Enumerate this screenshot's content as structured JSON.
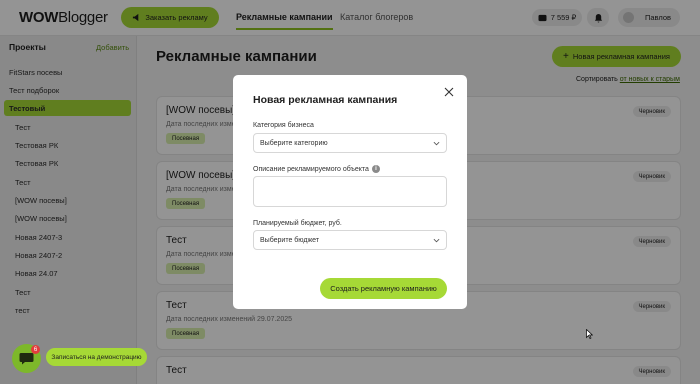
{
  "header": {
    "logo_bold": "WOW",
    "logo_rest": "Blogger",
    "order_button": "Заказать рекламу",
    "tabs": [
      {
        "label": "Рекламные кампании"
      },
      {
        "label": "Каталог блогеров"
      }
    ],
    "balance": "7 559 ₽",
    "user_name": "Павлов"
  },
  "sidebar": {
    "title": "Проекты",
    "add_label": "Добавить",
    "items": [
      {
        "label": "FitStars посевы"
      },
      {
        "label": "Тест подборок"
      },
      {
        "label": "Тестовый"
      },
      {
        "label": "Тест"
      },
      {
        "label": "Тестовая РК"
      },
      {
        "label": "Тестовая РК"
      },
      {
        "label": "Тест"
      },
      {
        "label": "[WOW посевы]"
      },
      {
        "label": "[WOW посевы]"
      },
      {
        "label": "Новая 2407-3"
      },
      {
        "label": "Новая 2407-2"
      },
      {
        "label": "Новая 24.07"
      },
      {
        "label": "Тест"
      },
      {
        "label": "тест"
      }
    ]
  },
  "main": {
    "title": "Рекламные кампании",
    "new_button": "Новая рекламная кампания",
    "sort_label": "Сортировать",
    "sort_value": "от новых к старым",
    "cards": [
      {
        "title": "[WOW посевы]",
        "date": "Дата последних изменений 29.07.2025",
        "tag": "Посевная",
        "status": "Черновик"
      },
      {
        "title": "[WOW посевы]",
        "date": "Дата последних изменений 29.07.2025",
        "tag": "Посевная",
        "status": "Черновик"
      },
      {
        "title": "Тест",
        "date": "Дата последних изменений 29.07.2025",
        "tag": "Посевная",
        "status": "Черновик"
      },
      {
        "title": "Тест",
        "date": "Дата последних изменений 29.07.2025",
        "tag": "Посевная",
        "status": "Черновик"
      },
      {
        "title": "Тест",
        "date": "",
        "tag": "",
        "status": "Черновик"
      }
    ]
  },
  "modal": {
    "title": "Новая рекламная кампания",
    "category_label": "Категория бизнеса",
    "category_placeholder": "Выберите категорию",
    "description_label": "Описание рекламируемого объекта",
    "budget_label": "Планируемый бюджет, руб.",
    "budget_placeholder": "Выберите бюджет",
    "submit": "Создать рекламную кампанию"
  },
  "widgets": {
    "chat_badge": "6",
    "demo_button": "Записаться на демонстрацию"
  },
  "colors": {
    "accent": "#a6d936",
    "accent_dark": "#7db82a",
    "tag_bg": "#d9efae",
    "badge": "#e23c3c"
  }
}
